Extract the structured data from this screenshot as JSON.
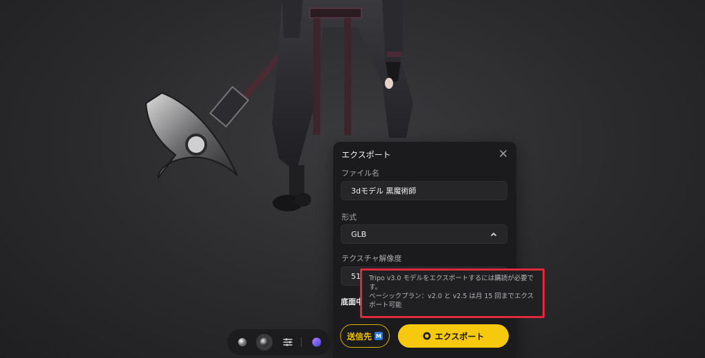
{
  "export_dialog": {
    "title": "エクスポート",
    "close_icon": "close-icon",
    "file_name": {
      "label": "ファイル名",
      "value": "3dモデル 黒魔術師"
    },
    "format": {
      "label": "形式",
      "selected": "GLB"
    },
    "texture_resolution": {
      "label": "テクスチャ解像度",
      "value_partial": "51"
    },
    "bottom_center_partial": "底面中",
    "send_to": {
      "label": "送信先",
      "badge": "M"
    },
    "export_button": {
      "label": "エクスポート",
      "icon": "export-icon"
    }
  },
  "tooltip": {
    "line1": "Tripo v3.0 モデルをエクスポートするには購読が必要です。",
    "line2": "ベーシックプラン：v2.0 と v2.5 は月 15 回までエクスポート可能"
  },
  "viewer_toolbar": {
    "items": [
      "matcap-sphere-icon",
      "shaded-sphere-icon",
      "sliders-icon",
      "gradient-sphere-icon"
    ],
    "accent": "#f6c90e",
    "highlight": "#e0293a"
  }
}
